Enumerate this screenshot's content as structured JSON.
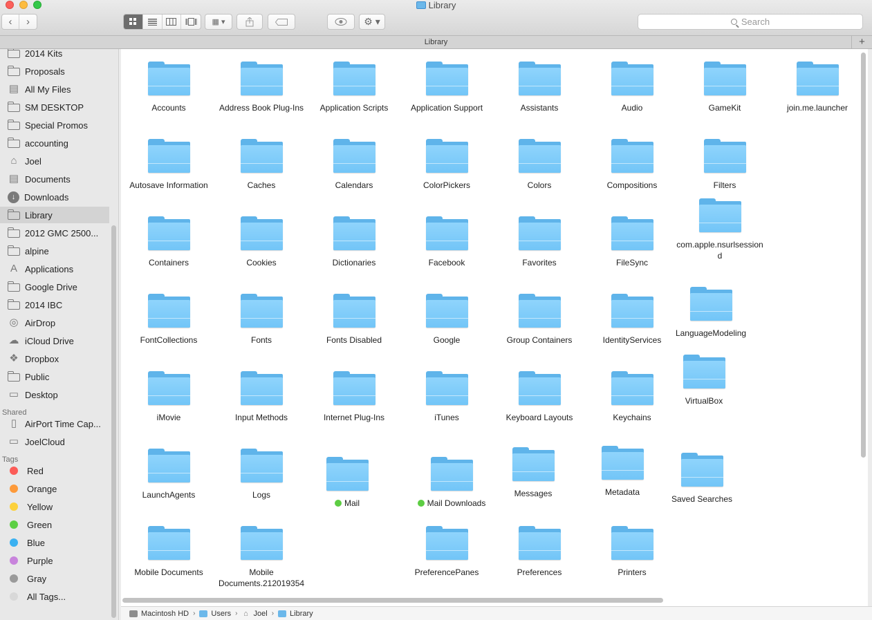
{
  "window": {
    "title": "Library"
  },
  "toolbar": {
    "back_glyph": "‹",
    "forward_glyph": "›",
    "view_icons": [
      "icon-view-icon",
      "list-view-icon",
      "column-view-icon",
      "coverflow-view-icon"
    ],
    "arrange_glyph": "▦ ▾",
    "action_glyph": "⚙ ▾",
    "search_placeholder": "Search"
  },
  "tabbar": {
    "title": "Library",
    "add_glyph": "+"
  },
  "sidebar": {
    "favorites": [
      {
        "label": "2014 Kits",
        "icon": "folder-icon"
      },
      {
        "label": "Proposals",
        "icon": "folder-icon"
      },
      {
        "label": "All My Files",
        "icon": "all-files-icon"
      },
      {
        "label": "SM DESKTOP",
        "icon": "folder-icon"
      },
      {
        "label": "Special Promos",
        "icon": "folder-icon"
      },
      {
        "label": "accounting",
        "icon": "folder-icon"
      },
      {
        "label": "Joel",
        "icon": "home-icon"
      },
      {
        "label": "Documents",
        "icon": "documents-icon"
      },
      {
        "label": "Downloads",
        "icon": "downloads-icon"
      },
      {
        "label": "Library",
        "icon": "folder-icon",
        "selected": true
      },
      {
        "label": "2012 GMC 2500...",
        "icon": "folder-icon"
      },
      {
        "label": "alpine",
        "icon": "folder-icon"
      },
      {
        "label": "Applications",
        "icon": "applications-icon"
      },
      {
        "label": "Google Drive",
        "icon": "folder-icon"
      },
      {
        "label": "2014 IBC",
        "icon": "folder-icon"
      },
      {
        "label": "AirDrop",
        "icon": "airdrop-icon"
      },
      {
        "label": "iCloud Drive",
        "icon": "cloud-icon"
      },
      {
        "label": "Dropbox",
        "icon": "dropbox-icon"
      },
      {
        "label": "Public",
        "icon": "folder-icon"
      },
      {
        "label": "Desktop",
        "icon": "desktop-icon"
      }
    ],
    "shared_header": "Shared",
    "shared": [
      {
        "label": "AirPort Time Cap...",
        "icon": "time-capsule-icon"
      },
      {
        "label": "JoelCloud",
        "icon": "computer-icon"
      }
    ],
    "tags_header": "Tags",
    "tags": [
      {
        "label": "Red",
        "color": "#fc5c58"
      },
      {
        "label": "Orange",
        "color": "#fd9a3a"
      },
      {
        "label": "Yellow",
        "color": "#fcd13c"
      },
      {
        "label": "Green",
        "color": "#5ccf44"
      },
      {
        "label": "Blue",
        "color": "#3bb1f1"
      },
      {
        "label": "Purple",
        "color": "#c884dc"
      },
      {
        "label": "Gray",
        "color": "#9a9a9a"
      },
      {
        "label": "All Tags...",
        "color": "#d8d8d8"
      }
    ]
  },
  "items": [
    {
      "label": "Accounts"
    },
    {
      "label": "Address Book Plug-Ins"
    },
    {
      "label": "Application Scripts"
    },
    {
      "label": "Application Support"
    },
    {
      "label": "Assistants"
    },
    {
      "label": "Audio"
    },
    {
      "label": "GameKit"
    },
    {
      "label": "join.me.launcher"
    },
    {
      "label": "Autosave Information"
    },
    {
      "label": "Caches"
    },
    {
      "label": "Calendars"
    },
    {
      "label": "ColorPickers"
    },
    {
      "label": "Colors"
    },
    {
      "label": "Compositions"
    },
    {
      "label": "Filters"
    },
    {
      "label": "Containers"
    },
    {
      "label": "Cookies"
    },
    {
      "label": "Dictionaries"
    },
    {
      "label": "Facebook"
    },
    {
      "label": "Favorites"
    },
    {
      "label": "FileSync"
    },
    {
      "label": "com.apple.nsurlsessiond"
    },
    {
      "label": "FontCollections"
    },
    {
      "label": "Fonts"
    },
    {
      "label": "Fonts Disabled"
    },
    {
      "label": "Google"
    },
    {
      "label": "Group Containers"
    },
    {
      "label": "IdentityServices"
    },
    {
      "label": "LanguageModeling"
    },
    {
      "label": "iMovie"
    },
    {
      "label": "Input Methods"
    },
    {
      "label": "Internet Plug-Ins"
    },
    {
      "label": "iTunes"
    },
    {
      "label": "Keyboard Layouts"
    },
    {
      "label": "Keychains"
    },
    {
      "label": "VirtualBox"
    },
    {
      "label": "LaunchAgents"
    },
    {
      "label": "Logs"
    },
    {
      "label": "Mail",
      "tag": "Green"
    },
    {
      "label": "Mail Downloads",
      "tag": "Green"
    },
    {
      "label": "Messages"
    },
    {
      "label": "Metadata"
    },
    {
      "label": "Saved Searches"
    },
    {
      "label": "Mobile Documents"
    },
    {
      "label": "Mobile Documents.212019354"
    },
    {
      "label": "PreferencePanes"
    },
    {
      "label": "Preferences"
    },
    {
      "label": "Printers"
    }
  ],
  "pathbar": [
    {
      "label": "Macintosh HD",
      "icon": "hard-drive-icon"
    },
    {
      "label": "Users",
      "icon": "users-folder-icon"
    },
    {
      "label": "Joel",
      "icon": "home-icon"
    },
    {
      "label": "Library",
      "icon": "library-folder-icon"
    }
  ],
  "pathbar_separator": "›"
}
